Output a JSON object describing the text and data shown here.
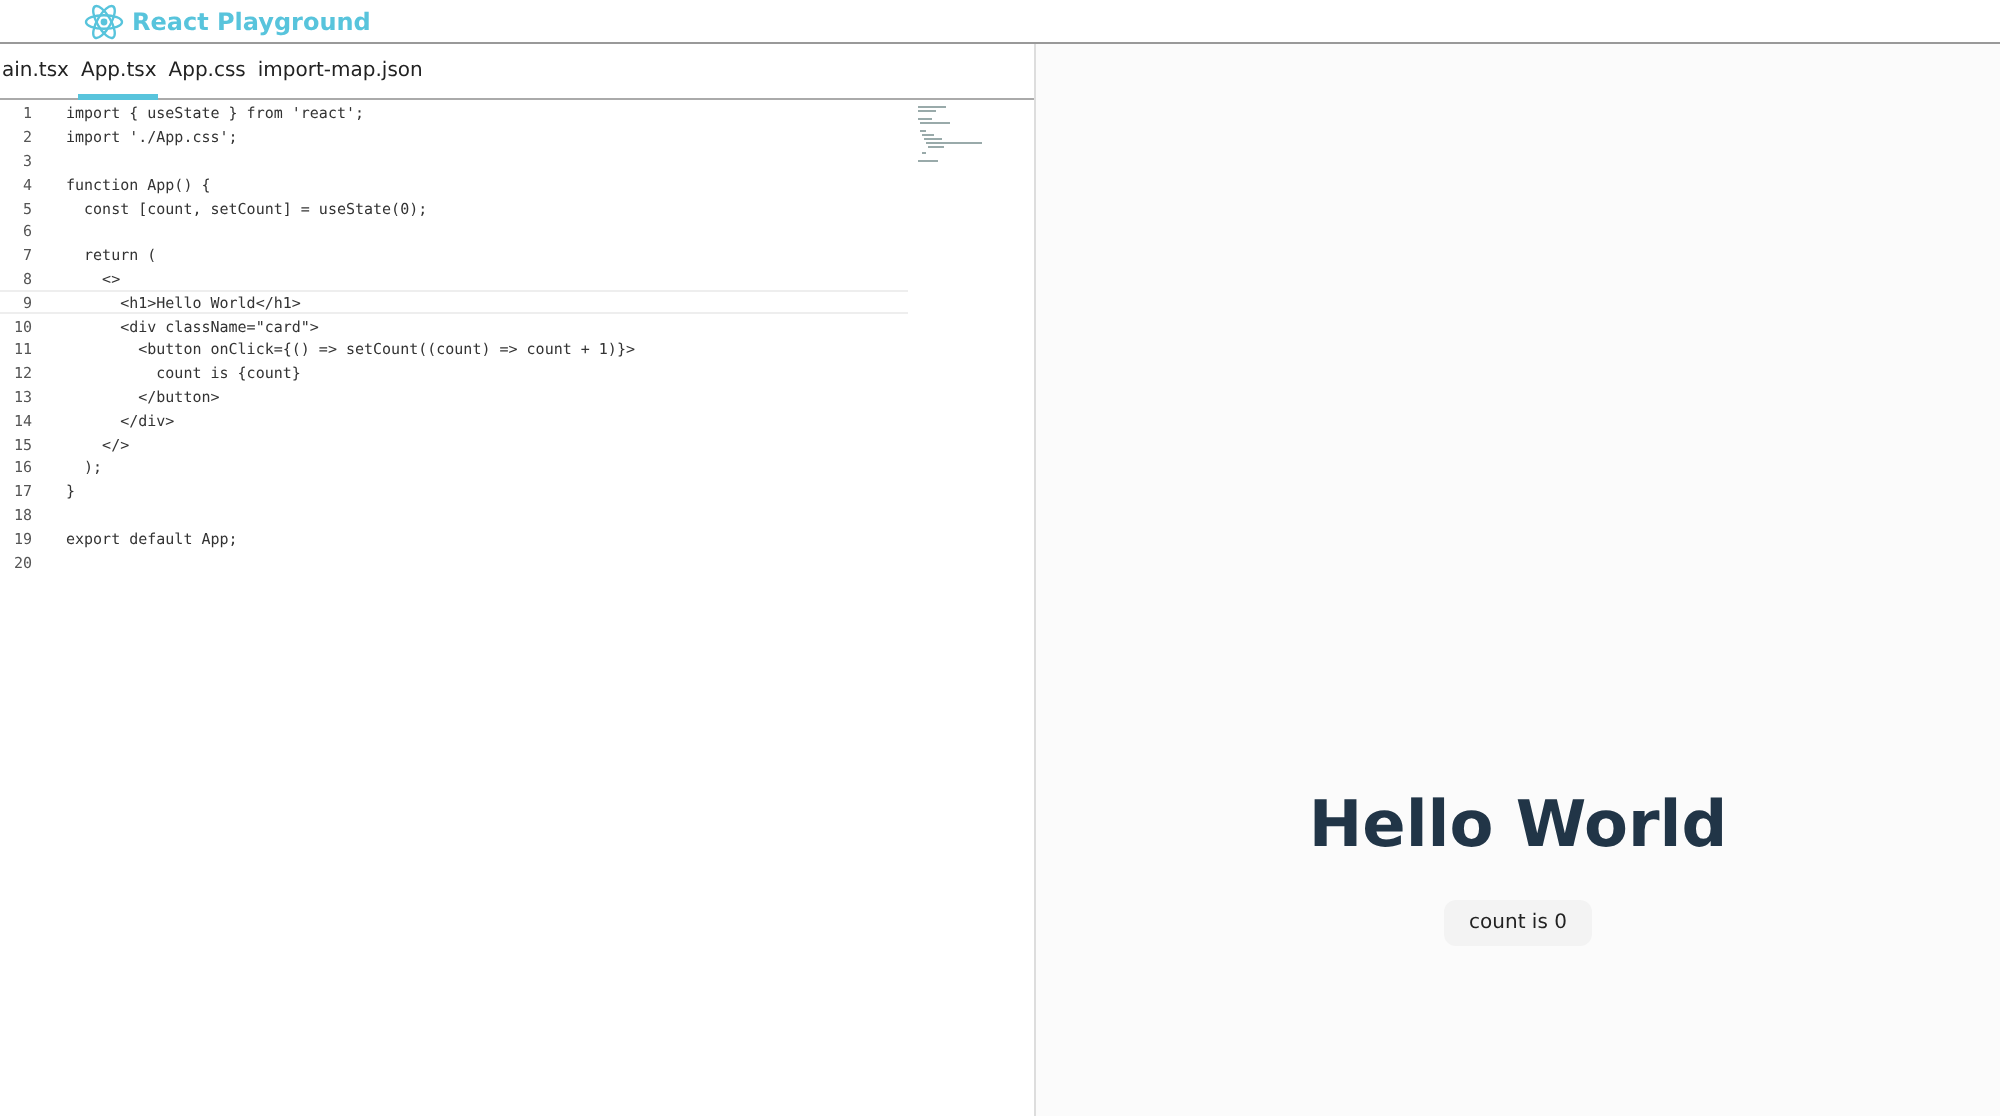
{
  "header": {
    "title": "React Playground"
  },
  "tabs": [
    {
      "label": "ain.tsx",
      "selected": false
    },
    {
      "label": "App.tsx",
      "selected": true
    },
    {
      "label": "App.css",
      "selected": false
    },
    {
      "label": "import-map.json",
      "selected": false
    }
  ],
  "editor": {
    "lines": [
      {
        "number": "1",
        "code": "import { useState } from 'react';",
        "current": false
      },
      {
        "number": "2",
        "code": "import './App.css';",
        "current": false
      },
      {
        "number": "3",
        "current": false
      },
      {
        "number": "4",
        "code": "function App() {",
        "current": false
      },
      {
        "number": "5",
        "code": "  const [count, setCount] = useState(0);",
        "current": false
      },
      {
        "number": "6",
        "current": false
      },
      {
        "number": "7",
        "code": "  return (",
        "current": false
      },
      {
        "number": "8",
        "code": "    <>",
        "current": false
      },
      {
        "number": "9",
        "code": "      <h1>Hello World</h1>",
        "current": true
      },
      {
        "number": "10",
        "code": "      <div className=\"card\">",
        "current": false
      },
      {
        "number": "11",
        "code": "        <button onClick={() => setCount((count) => count + 1)}>",
        "current": false
      },
      {
        "number": "12",
        "code": "          count is {count}",
        "current": false
      },
      {
        "number": "13",
        "code": "        </button>",
        "current": false
      },
      {
        "number": "14",
        "code": "      </div>",
        "current": false
      },
      {
        "number": "15",
        "code": "    </>",
        "current": false
      },
      {
        "number": "16",
        "code": "  );",
        "current": false
      },
      {
        "number": "17",
        "code": "}",
        "current": false
      },
      {
        "number": "18",
        "current": false
      },
      {
        "number": "19",
        "code": "export default App;",
        "current": false
      },
      {
        "number": "20",
        "current": false
      }
    ]
  },
  "preview": {
    "heading": "Hello World",
    "button": "count is 0"
  }
}
